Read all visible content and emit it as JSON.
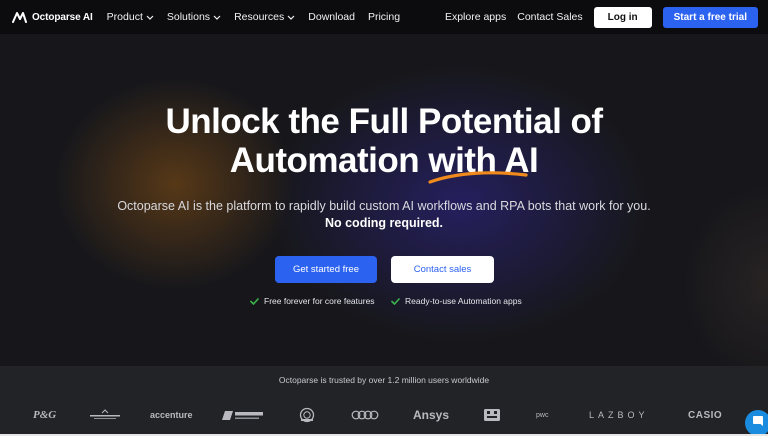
{
  "brand": {
    "name": "Octoparse AI",
    "logo_icon": "octoparse-logo-icon"
  },
  "nav": {
    "items": [
      {
        "label": "Product",
        "has_dropdown": true
      },
      {
        "label": "Solutions",
        "has_dropdown": true
      },
      {
        "label": "Resources",
        "has_dropdown": true
      },
      {
        "label": "Download",
        "has_dropdown": false
      },
      {
        "label": "Pricing",
        "has_dropdown": false
      }
    ],
    "right": {
      "explore": "Explore apps",
      "contact": "Contact Sales",
      "login": "Log in",
      "trial": "Start a free trial"
    }
  },
  "hero": {
    "headline_line1": "Unlock the Full Potential of",
    "headline_line2": "Automation with AI",
    "subtitle": "Octoparse AI is the platform to rapidly build custom AI workflows and RPA bots that work for you.",
    "subtitle_bold": "No coding required.",
    "primary_button": "Get started free",
    "secondary_button": "Contact sales",
    "features": [
      "Free forever for core features",
      "Ready-to-use Automation apps"
    ]
  },
  "trust": {
    "text": "Octoparse is trusted by over 1.2 million users worldwide",
    "logos": [
      "P&G",
      "LEE FORD",
      "accenture",
      "PURDUE",
      "seal",
      "audi",
      "Ansys",
      "bbb",
      "pwc",
      "LAZBOY",
      "CASIO"
    ]
  },
  "colors": {
    "accent": "#2b62f0",
    "underline_orange": "#f08a1c",
    "check_green": "#3bb54a",
    "chat_blue": "#1a8ce0"
  }
}
